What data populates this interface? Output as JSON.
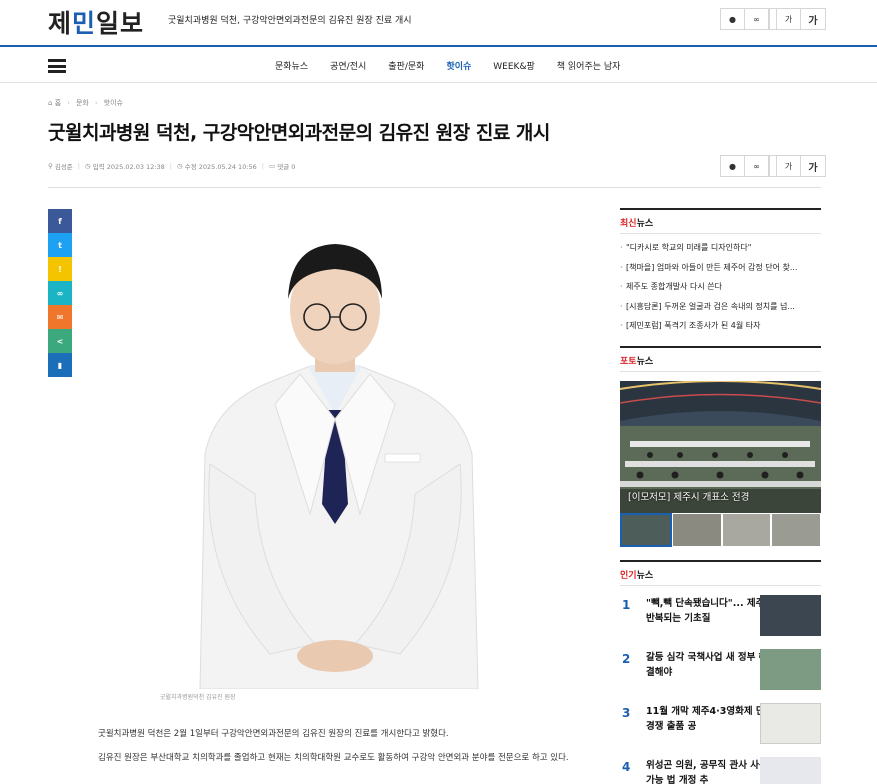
{
  "site": {
    "logo": "제민일보",
    "top_headline": "굿윌치과병원 덕천, 구강악안면외과전문의 김유진 원장 진료 개시"
  },
  "toolbar": {
    "print_icon": "print-icon",
    "share_icon": "link-icon",
    "font_small": "가",
    "font_large": "가"
  },
  "nav": {
    "items": [
      "문화뉴스",
      "공연/전시",
      "출판/문화",
      "핫이슈",
      "WEEK&팡",
      "책 읽어주는 남자"
    ],
    "active_index": 3
  },
  "breadcrumb": [
    "홈",
    "문화",
    "핫이슈"
  ],
  "article": {
    "title": "굿윌치과병원 덕천, 구강악안면외과전문의 김유진 원장 진료 개시",
    "author": "김성준",
    "created": "입력 2025.02.03 12:38",
    "modified": "수정 2025.05.24 10:56",
    "comments": "댓글 0",
    "caption": "굿윌치과병원덕천 김유진 원장",
    "paragraphs": [
      "굿윌치과병원 덕천은 2월 1일부터 구강악안면외과전문의 김유진 원장의 진료를 개시한다고 밝혔다.",
      "김유진 원장은 부산대학교 치의학과를 졸업하고 현재는 치의학대학원 교수로도 활동하여 구강악 안면외과 분야를 전문으로 하고 있다."
    ]
  },
  "share": {
    "buttons": [
      {
        "name": "facebook",
        "glyph": "f",
        "color": "#3b5998"
      },
      {
        "name": "twitter",
        "glyph": "t",
        "color": "#1da1f2"
      },
      {
        "name": "kakaostory",
        "glyph": "!",
        "color": "#f5c400"
      },
      {
        "name": "link",
        "glyph": "∞",
        "color": "#1bb4c4"
      },
      {
        "name": "email",
        "glyph": "✉",
        "color": "#f0762b"
      },
      {
        "name": "share",
        "glyph": "<",
        "color": "#3ba97d"
      },
      {
        "name": "bookmark",
        "glyph": "▮",
        "color": "#1b6fb8"
      }
    ]
  },
  "sidebar": {
    "latest": {
      "head_hl": "최신",
      "head_rest": "뉴스",
      "items": [
        "\"디카시로 학교의 미래를 디자인하다\"",
        "[책마을] 엄마와 아들이 만든 제주어 감정 단어 찾...",
        "제주도 종합개발사 다시 쓴다",
        "[시흥담론] 두꺼운 얼굴과 검은 속내의 정치를 넘...",
        "[제민포럼] 폭격기 조종사가 된 4월 타자"
      ]
    },
    "photo": {
      "head_hl": "포토",
      "head_rest": "뉴스",
      "caption": "[이모저모] 제주시 개표소 전경"
    },
    "popular": {
      "head_hl": "인기",
      "head_rest": "뉴스",
      "items": [
        {
          "rank": "1",
          "text": "\"빽,빽 단속됐습니다\"... 제주서 반복되는 기초질"
        },
        {
          "rank": "2",
          "text": "갈등 심각 국책사업 새 정부 해결해야"
        },
        {
          "rank": "3",
          "text": "11월 개막 제주4·3영화제 단편경쟁 출품 공"
        },
        {
          "rank": "4",
          "text": "위성곤 의원, 공무직 관사 사용 가능 법 개정 추"
        }
      ]
    }
  }
}
